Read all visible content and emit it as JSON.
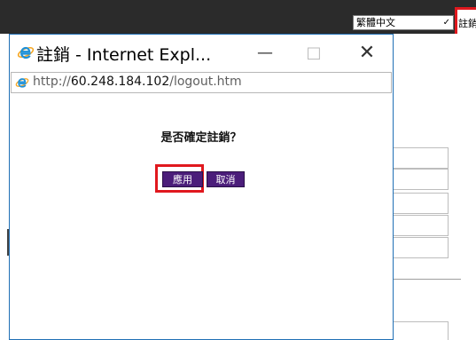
{
  "background": {
    "language_select": {
      "value": "繁體中文"
    },
    "logout_link": "註銷"
  },
  "window": {
    "title": "註銷 - Internet Expl...",
    "controls": {
      "minimize": "—",
      "maximize": "□",
      "close": "✕"
    },
    "address": {
      "prefix": "http://",
      "host": "60.248.184.102",
      "path": "/logout.htm"
    }
  },
  "dialog": {
    "question": "是否確定註銷？",
    "apply_label": "應用",
    "cancel_label": "取消"
  },
  "colors": {
    "button_bg": "#4b1d7a",
    "highlight": "#e0181e",
    "window_border": "#1f6fb5",
    "topbar": "#2b2b2b"
  },
  "icons": [
    "internet-explorer-icon",
    "chevron-down-icon"
  ]
}
